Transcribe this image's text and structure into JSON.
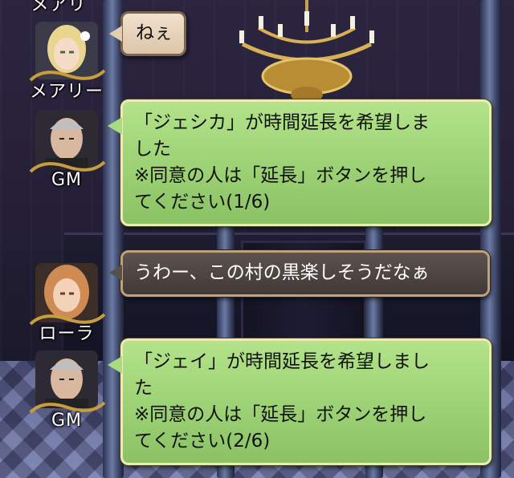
{
  "messages": [
    {
      "speaker": "メアリ",
      "text": "",
      "partial": true
    },
    {
      "speaker": "メアリー",
      "text": "ねぇ",
      "style": "cream"
    },
    {
      "speaker": "GM",
      "lines": [
        "「ジェシカ」が時間延長を希望しま",
        "した",
        "※同意の人は「延長」ボタンを押し",
        "てください(1/6)"
      ],
      "style": "green"
    },
    {
      "speaker": "ローラ",
      "text": "うわー、この村の黒楽しそうだなぁ",
      "style": "brown"
    },
    {
      "speaker": "GM",
      "lines": [
        "「ジェイ」が時間延長を希望しまし",
        "た",
        "※同意の人は「延長」ボタンを押し",
        "てください(2/6)"
      ],
      "style": "green"
    }
  ],
  "colors": {
    "gm_bubble": "#9fd676",
    "player_bubble": "#4b4340",
    "cream_bubble": "#ead7bd"
  }
}
